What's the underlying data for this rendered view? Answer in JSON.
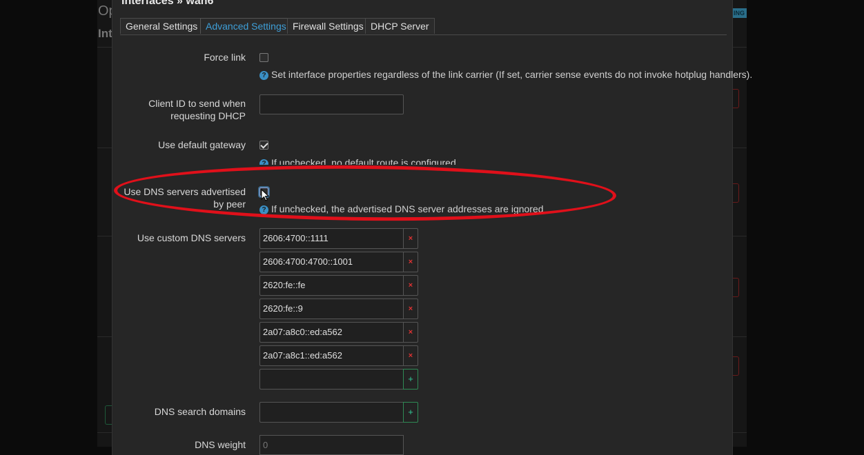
{
  "background": {
    "title_fragment": "Op",
    "subtitle_fragment": "Int",
    "badge_fragment": "ING"
  },
  "dialog": {
    "title": "Interfaces » wan6",
    "tabs": [
      {
        "label": "General Settings",
        "active": false
      },
      {
        "label": "Advanced Settings",
        "active": true
      },
      {
        "label": "Firewall Settings",
        "active": false
      },
      {
        "label": "DHCP Server",
        "active": false
      }
    ]
  },
  "form": {
    "force_link": {
      "label": "Force link",
      "checked": false,
      "help": "Set interface properties regardless of the link carrier (If set, carrier sense events do not invoke hotplug handlers)."
    },
    "client_id": {
      "label_line1": "Client ID to send when",
      "label_line2": "requesting DHCP",
      "value": ""
    },
    "default_gateway": {
      "label": "Use default gateway",
      "checked": true,
      "help": "If unchecked, no default route is configured"
    },
    "peer_dns": {
      "label_line1": "Use DNS servers advertised",
      "label_line2": "by peer",
      "checked": false,
      "help": "If unchecked, the advertised DNS server addresses are ignored"
    },
    "custom_dns": {
      "label": "Use custom DNS servers",
      "servers": [
        "2606:4700::1111",
        "2606:4700:4700::1001",
        "2620:fe::fe",
        "2620:fe::9",
        "2a07:a8c0::ed:a562",
        "2a07:a8c1::ed:a562"
      ],
      "remove_symbol": "×",
      "add_symbol": "+"
    },
    "dns_search": {
      "label": "DNS search domains",
      "add_symbol": "+"
    },
    "dns_weight": {
      "label": "DNS weight",
      "placeholder": "0"
    }
  },
  "annotation_color": "#e0101a"
}
